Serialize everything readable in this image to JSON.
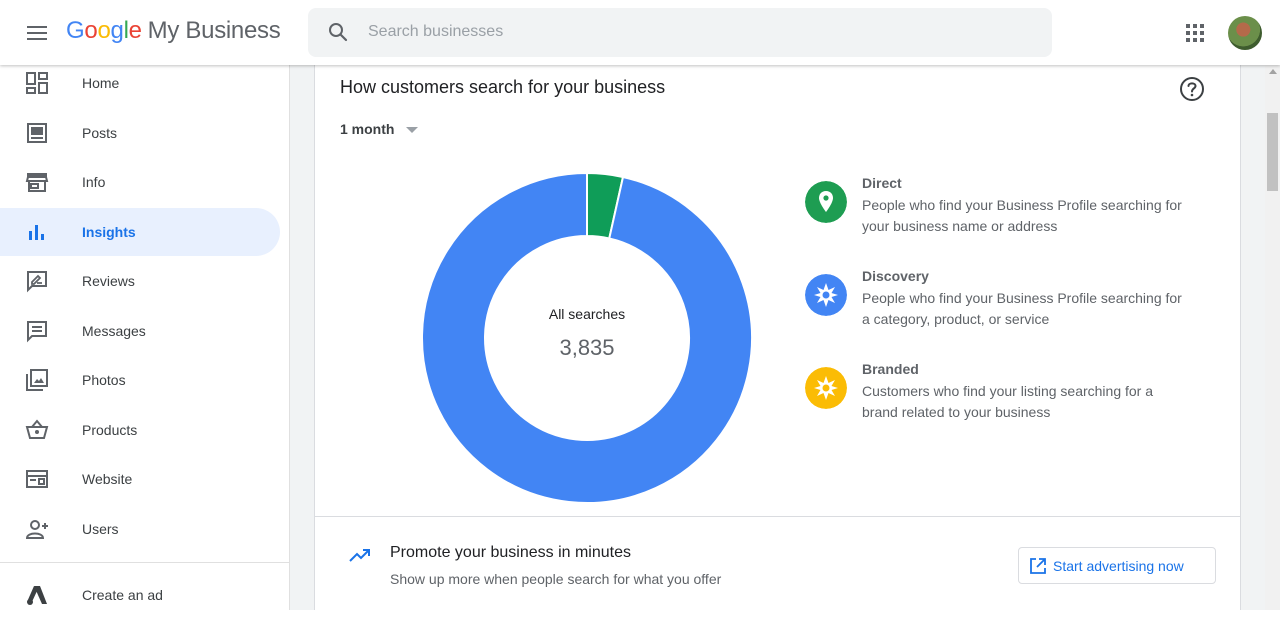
{
  "header": {
    "brand_google": [
      "G",
      "o",
      "o",
      "g",
      "l",
      "e"
    ],
    "brand_rest": "My Business",
    "search_placeholder": "Search businesses"
  },
  "sidebar": {
    "items": [
      {
        "label": "Home",
        "icon": "dashboard-icon"
      },
      {
        "label": "Posts",
        "icon": "posts-icon"
      },
      {
        "label": "Info",
        "icon": "storefront-icon"
      },
      {
        "label": "Insights",
        "icon": "bar-chart-icon",
        "active": true
      },
      {
        "label": "Reviews",
        "icon": "reviews-icon"
      },
      {
        "label": "Messages",
        "icon": "message-icon"
      },
      {
        "label": "Photos",
        "icon": "photos-icon"
      },
      {
        "label": "Products",
        "icon": "basket-icon"
      },
      {
        "label": "Website",
        "icon": "website-icon"
      },
      {
        "label": "Users",
        "icon": "add-user-icon"
      }
    ],
    "create_ad": {
      "label": "Create an ad",
      "icon": "google-ads-icon"
    }
  },
  "card": {
    "title": "How customers search for your business",
    "period": "1 month",
    "donut_label": "All searches",
    "donut_value": "3,835",
    "legend": [
      {
        "title": "Direct",
        "desc": "People who find your Business Profile searching for your business name or address",
        "color": "#1e9d52",
        "icon": "location-pin-icon"
      },
      {
        "title": "Discovery",
        "desc": "People who find your Business Profile searching for a category, product, or service",
        "color": "#4285f4",
        "icon": "discovery-icon"
      },
      {
        "title": "Branded",
        "desc": "Customers who find your listing searching for a brand related to your business",
        "color": "#fbbc05",
        "icon": "branded-icon"
      }
    ]
  },
  "chart_data": {
    "type": "pie",
    "slices": [
      {
        "name": "Direct",
        "value": 3.5,
        "color": "#0f9d58"
      },
      {
        "name": "Discovery",
        "value": 96.5,
        "color": "#4285f4"
      }
    ]
  },
  "promo": {
    "title": "Promote your business in minutes",
    "subtitle": "Show up more when people search for what you offer",
    "button_label": "Start advertising now"
  }
}
